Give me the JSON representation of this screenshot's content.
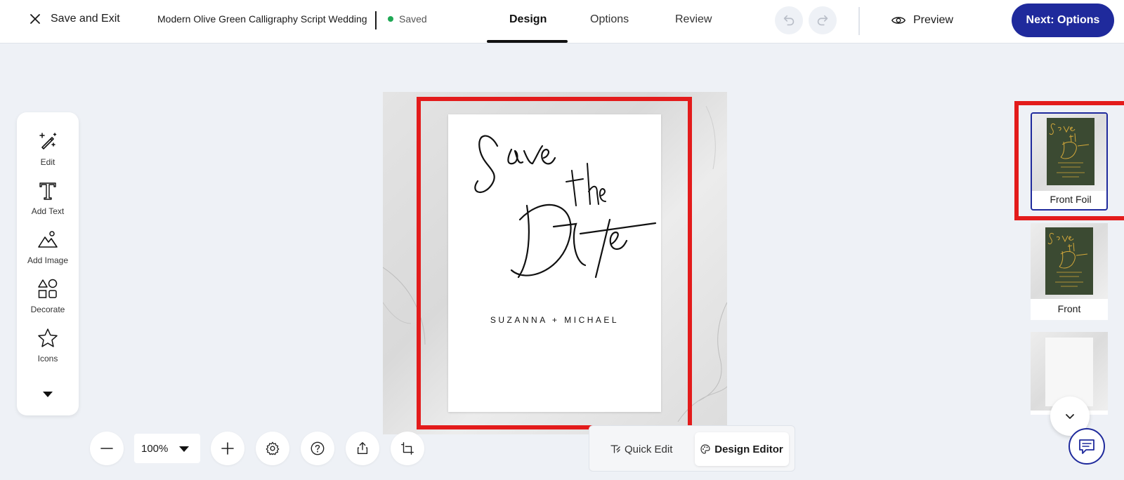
{
  "header": {
    "exit_label": "Save and Exit",
    "doc_title": "Modern Olive Green Calligraphy Script Wedding",
    "save_status": "Saved",
    "tabs": [
      {
        "label": "Design",
        "active": true
      },
      {
        "label": "Options",
        "active": false
      },
      {
        "label": "Review",
        "active": false
      }
    ],
    "preview_label": "Preview",
    "next_label": "Next: Options"
  },
  "tools": [
    {
      "label": "Edit",
      "icon": "magic-pencil-icon"
    },
    {
      "label": "Add Text",
      "icon": "text-t-icon"
    },
    {
      "label": "Add Image",
      "icon": "image-mountain-icon"
    },
    {
      "label": "Decorate",
      "icon": "shapes-icon"
    },
    {
      "label": "Icons",
      "icon": "star-icon"
    }
  ],
  "canvas": {
    "names": "SUZANNA + MICHAEL"
  },
  "controls": {
    "zoom": "100%",
    "quick_edit_label": "Quick Edit",
    "design_editor_label": "Design Editor"
  },
  "thumbnails": [
    {
      "label": "Front Foil",
      "selected": true
    },
    {
      "label": "Front",
      "selected": false
    },
    {
      "label": "",
      "selected": false
    }
  ],
  "colors": {
    "accent": "#1f2a9c",
    "highlight": "#e31b1b",
    "saved_dot": "#1fa855",
    "olive": "#3b4a32",
    "gold_foil": "#d4a83a"
  }
}
